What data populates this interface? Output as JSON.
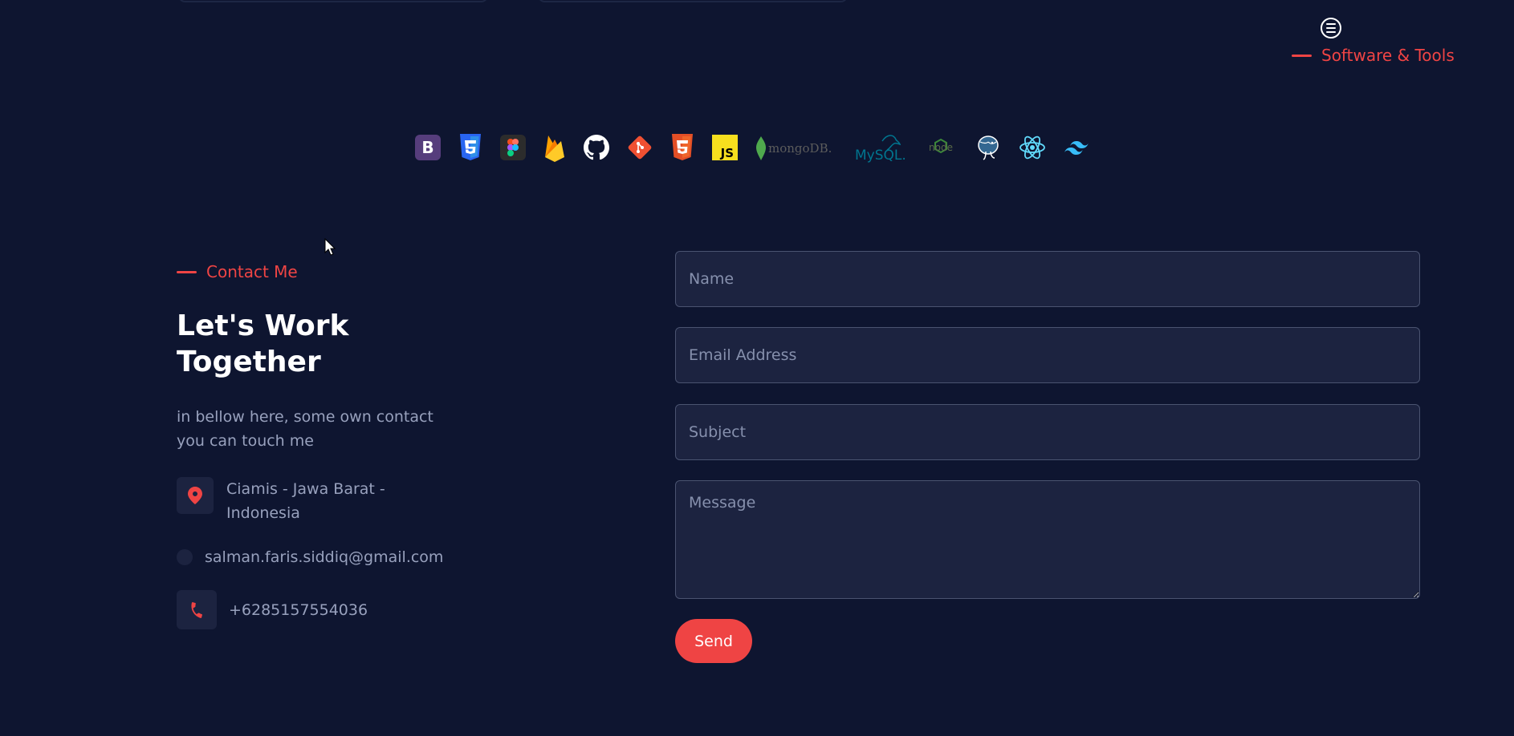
{
  "menu": {
    "icon": "menu-lines-icon"
  },
  "tools_section": {
    "tag": "Software & Tools",
    "tools": [
      {
        "id": "bootstrap",
        "icon": "bootstrap-icon",
        "color": "#7952b3"
      },
      {
        "id": "css3",
        "icon": "css3-icon",
        "color": "#2965f1"
      },
      {
        "id": "figma",
        "icon": "figma-icon",
        "color": "#f24e1e"
      },
      {
        "id": "firebase",
        "icon": "firebase-icon",
        "color": "#ffca28"
      },
      {
        "id": "github",
        "icon": "github-icon",
        "color": "#ffffff"
      },
      {
        "id": "git",
        "icon": "git-icon",
        "color": "#f05032"
      },
      {
        "id": "html5",
        "icon": "html5-icon",
        "color": "#e34f26"
      },
      {
        "id": "javascript",
        "icon": "javascript-icon",
        "color": "#f7df1e"
      },
      {
        "id": "mongodb",
        "icon": "mongodb-logo",
        "color": "#4fa94d",
        "wordmark": "mongoDB."
      },
      {
        "id": "mysql",
        "icon": "mysql-logo",
        "color": "#00758f",
        "wordmark": "MySQL."
      },
      {
        "id": "nodejs",
        "icon": "nodejs-logo",
        "color": "#3c873a",
        "wordmark": "node"
      },
      {
        "id": "postgresql",
        "icon": "postgresql-icon",
        "color": "#336791"
      },
      {
        "id": "react",
        "icon": "react-icon",
        "color": "#61dafb"
      },
      {
        "id": "tailwind",
        "icon": "tailwind-icon",
        "color": "#38bdf8"
      }
    ]
  },
  "contact": {
    "tag": "Contact Me",
    "title": "Let's Work Together",
    "description": "in bellow here, some own contact you can touch me",
    "location": "Ciamis - Jawa Barat - Indonesia",
    "email": "salman.faris.siddiq@gmail.com",
    "phone": "+6285157554036"
  },
  "form": {
    "name_placeholder": "Name",
    "email_placeholder": "Email Address",
    "subject_placeholder": "Subject",
    "message_placeholder": "Message",
    "send_label": "Send"
  },
  "colors": {
    "accent": "#ef4444",
    "background": "#0e1530",
    "field_bg": "#1c2340"
  }
}
